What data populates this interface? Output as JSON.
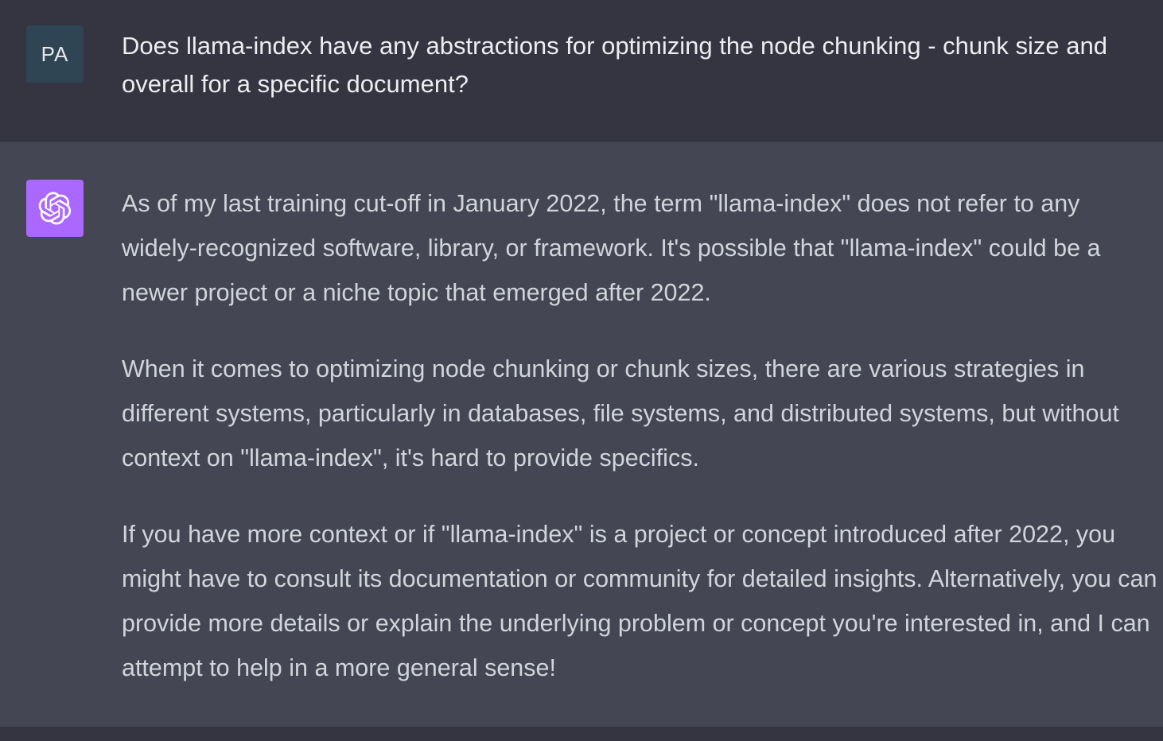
{
  "conversation": {
    "user_message": {
      "avatar_initials": "PA",
      "text": "Does llama-index have any abstractions for optimizing the node chunking - chunk size and overall for a specific document?"
    },
    "assistant_message": {
      "avatar_icon": "openai-logo-icon",
      "paragraphs": [
        "As of my last training cut-off in January 2022, the term \"llama-index\" does not refer to any widely-recognized software, library, or framework. It's possible that \"llama-index\" could be a newer project or a niche topic that emerged after 2022.",
        "When it comes to optimizing node chunking or chunk sizes, there are various strategies in different systems, particularly in databases, file systems, and distributed systems, but without context on \"llama-index\", it's hard to provide specifics.",
        "If you have more context or if \"llama-index\" is a project or concept introduced after 2022, you might have to consult its documentation or community for detailed insights. Alternatively, you can provide more details or explain the underlying problem or concept you're interested in, and I can attempt to help in a more general sense!"
      ]
    }
  },
  "colors": {
    "user_bg": "#343541",
    "assistant_bg": "#444654",
    "user_avatar_bg": "#2f4553",
    "assistant_avatar_bg": "#ab68ff"
  }
}
